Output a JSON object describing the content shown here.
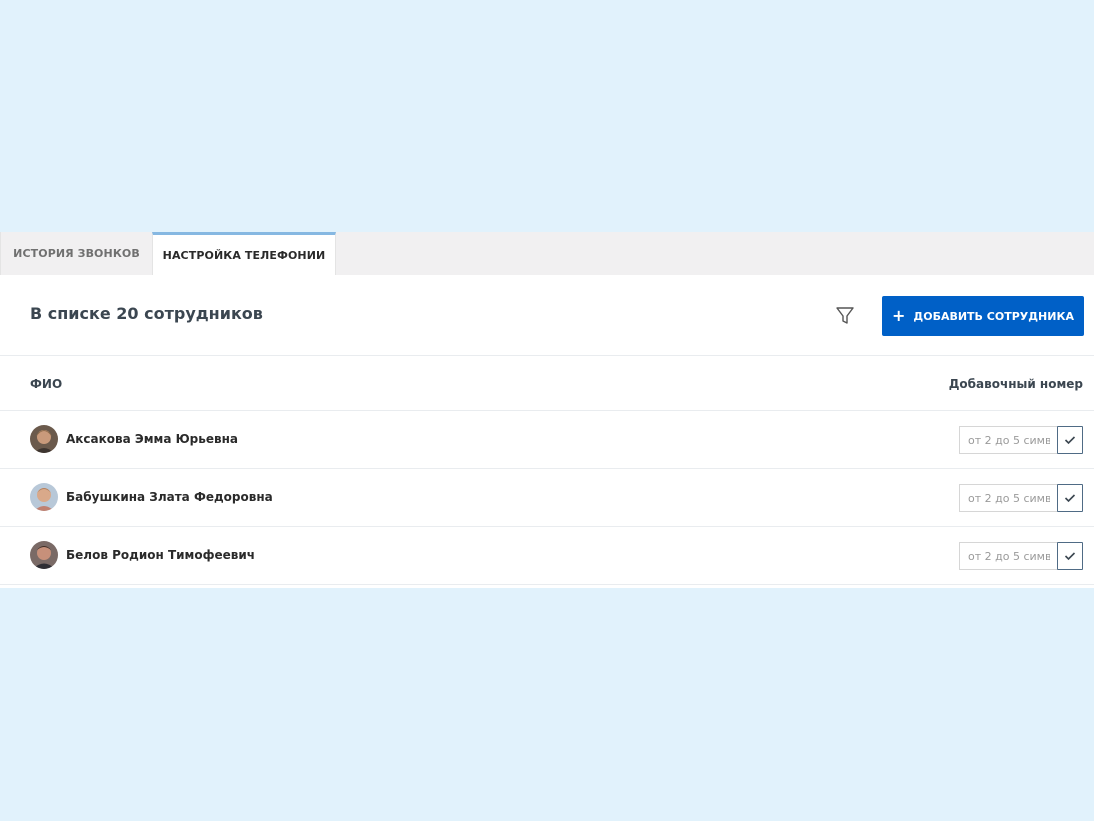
{
  "tabs": [
    {
      "label": "ИСТОРИЯ ЗВОНКОВ",
      "active": false
    },
    {
      "label": "НАСТРОЙКА ТЕЛЕФОНИИ",
      "active": true
    }
  ],
  "header": {
    "count_text": "В списке 20 сотрудников",
    "filter_icon": "funnel-icon",
    "add_button_label": "ДОБАВИТЬ СОТРУДНИКА",
    "add_button_icon": "plus-icon"
  },
  "table": {
    "columns": [
      "ФИО",
      "Добавочный номер"
    ],
    "rows": [
      {
        "name": "Аксакова Эмма Юрьевна",
        "extension": "",
        "placeholder": "от 2 до 5 симв."
      },
      {
        "name": "Бабушкина Злата Федоровна",
        "extension": "",
        "placeholder": "от 2 до 5 симв."
      },
      {
        "name": "Белов Родион Тимофеевич",
        "extension": "",
        "placeholder": "от 2 до 5 симв."
      }
    ]
  },
  "colors": {
    "background": "#e1f2fc",
    "accent": "#0060c7",
    "active_tab_border": "#86b8e2"
  }
}
